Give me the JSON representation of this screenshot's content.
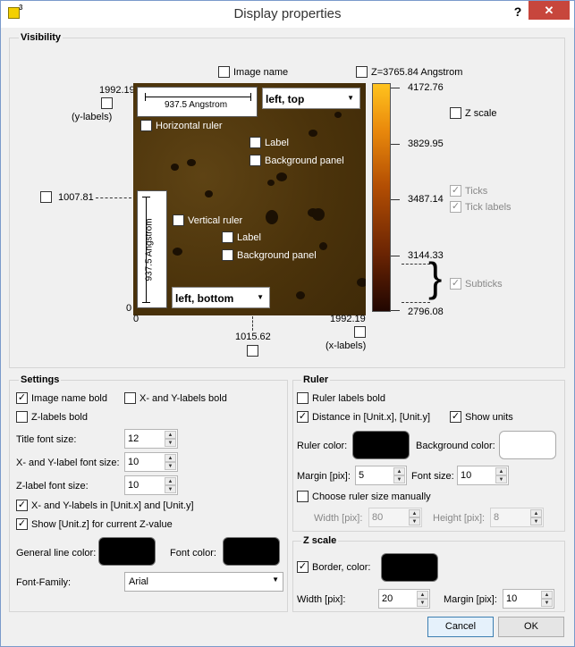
{
  "window": {
    "title": "Display properties",
    "icon_sup": "3",
    "help_symbol": "?",
    "close_symbol": "✕"
  },
  "visibility": {
    "group_label": "Visibility",
    "image_name_label": "Image name",
    "z_value_label": "Z=3765.84 Angstrom",
    "z_scale_label": "Z scale",
    "ticks_label": "Ticks",
    "tick_labels_label": "Tick labels",
    "subticks_label": "Subticks",
    "y_top_value": "1992.19",
    "y_labels_caption": "(y-labels)",
    "y_mid_value": "1007.81",
    "y_zero": "0",
    "x_zero": "0",
    "x_right_value": "1992.19",
    "x_labels_caption": "(x-labels)",
    "x_mid_value": "1015.62",
    "hruler_text": "937.5 Angstrom",
    "vruler_text": "937.5 Angstrom",
    "hruler_position": "left, top",
    "vruler_position": "left, bottom",
    "horizontal_ruler_label": "Horizontal ruler",
    "vertical_ruler_label": "Vertical ruler",
    "label_label": "Label",
    "background_panel_label": "Background panel",
    "colorbar_ticks": [
      "4172.76",
      "3829.95",
      "3487.14",
      "3144.33",
      "2796.08"
    ],
    "states": {
      "image_name": false,
      "z_value": false,
      "z_scale": false,
      "ticks": true,
      "tick_labels": true,
      "subticks": true,
      "y_top": false,
      "y_mid": false,
      "x_right": false,
      "x_mid": false,
      "horizontal_ruler": false,
      "h_label": false,
      "h_background": false,
      "vertical_ruler": false,
      "v_label": false,
      "v_background": false
    }
  },
  "settings": {
    "group_label": "Settings",
    "image_name_bold": "Image name bold",
    "xy_labels_bold": "X- and Y-labels bold",
    "z_labels_bold": "Z-labels bold",
    "title_font_size_label": "Title font size:",
    "title_font_size": "12",
    "xy_font_size_label": "X- and Y-label font size:",
    "xy_font_size": "10",
    "z_font_size_label": "Z-label font size:",
    "z_font_size": "10",
    "xy_units_label": "X- and Y-labels in [Unit.x] and [Unit.y]",
    "show_unit_z_label": "Show [Unit.z] for current Z-value",
    "general_line_color_label": "General line color:",
    "font_color_label": "Font color:",
    "font_family_label": "Font-Family:",
    "font_family": "Arial",
    "general_line_color": "#000000",
    "font_color": "#000000",
    "states": {
      "image_name_bold": true,
      "xy_labels_bold": false,
      "z_labels_bold": false,
      "xy_units": true,
      "show_unit_z": true
    }
  },
  "ruler": {
    "group_label": "Ruler",
    "ruler_labels_bold": "Ruler labels bold",
    "distance_label": "Distance in [Unit.x], [Unit.y]",
    "show_units_label": "Show units",
    "ruler_color_label": "Ruler color:",
    "background_color_label": "Background color:",
    "margin_label": "Margin [pix]:",
    "margin": "5",
    "font_size_label": "Font size:",
    "font_size": "10",
    "choose_size_label": "Choose ruler size manually",
    "width_label": "Width [pix]:",
    "width": "80",
    "height_label": "Height [pix]:",
    "height": "8",
    "ruler_color": "#000000",
    "background_color": "#ffffff",
    "states": {
      "ruler_labels_bold": false,
      "distance": true,
      "show_units": true,
      "choose_size": false
    }
  },
  "zscale": {
    "group_label": "Z scale",
    "border_color_label": "Border, color:",
    "width_label": "Width [pix]:",
    "width": "20",
    "margin_label": "Margin [pix]:",
    "margin": "10",
    "border_color": "#000000",
    "states": {
      "border": true
    }
  },
  "buttons": {
    "cancel": "Cancel",
    "ok": "OK"
  }
}
